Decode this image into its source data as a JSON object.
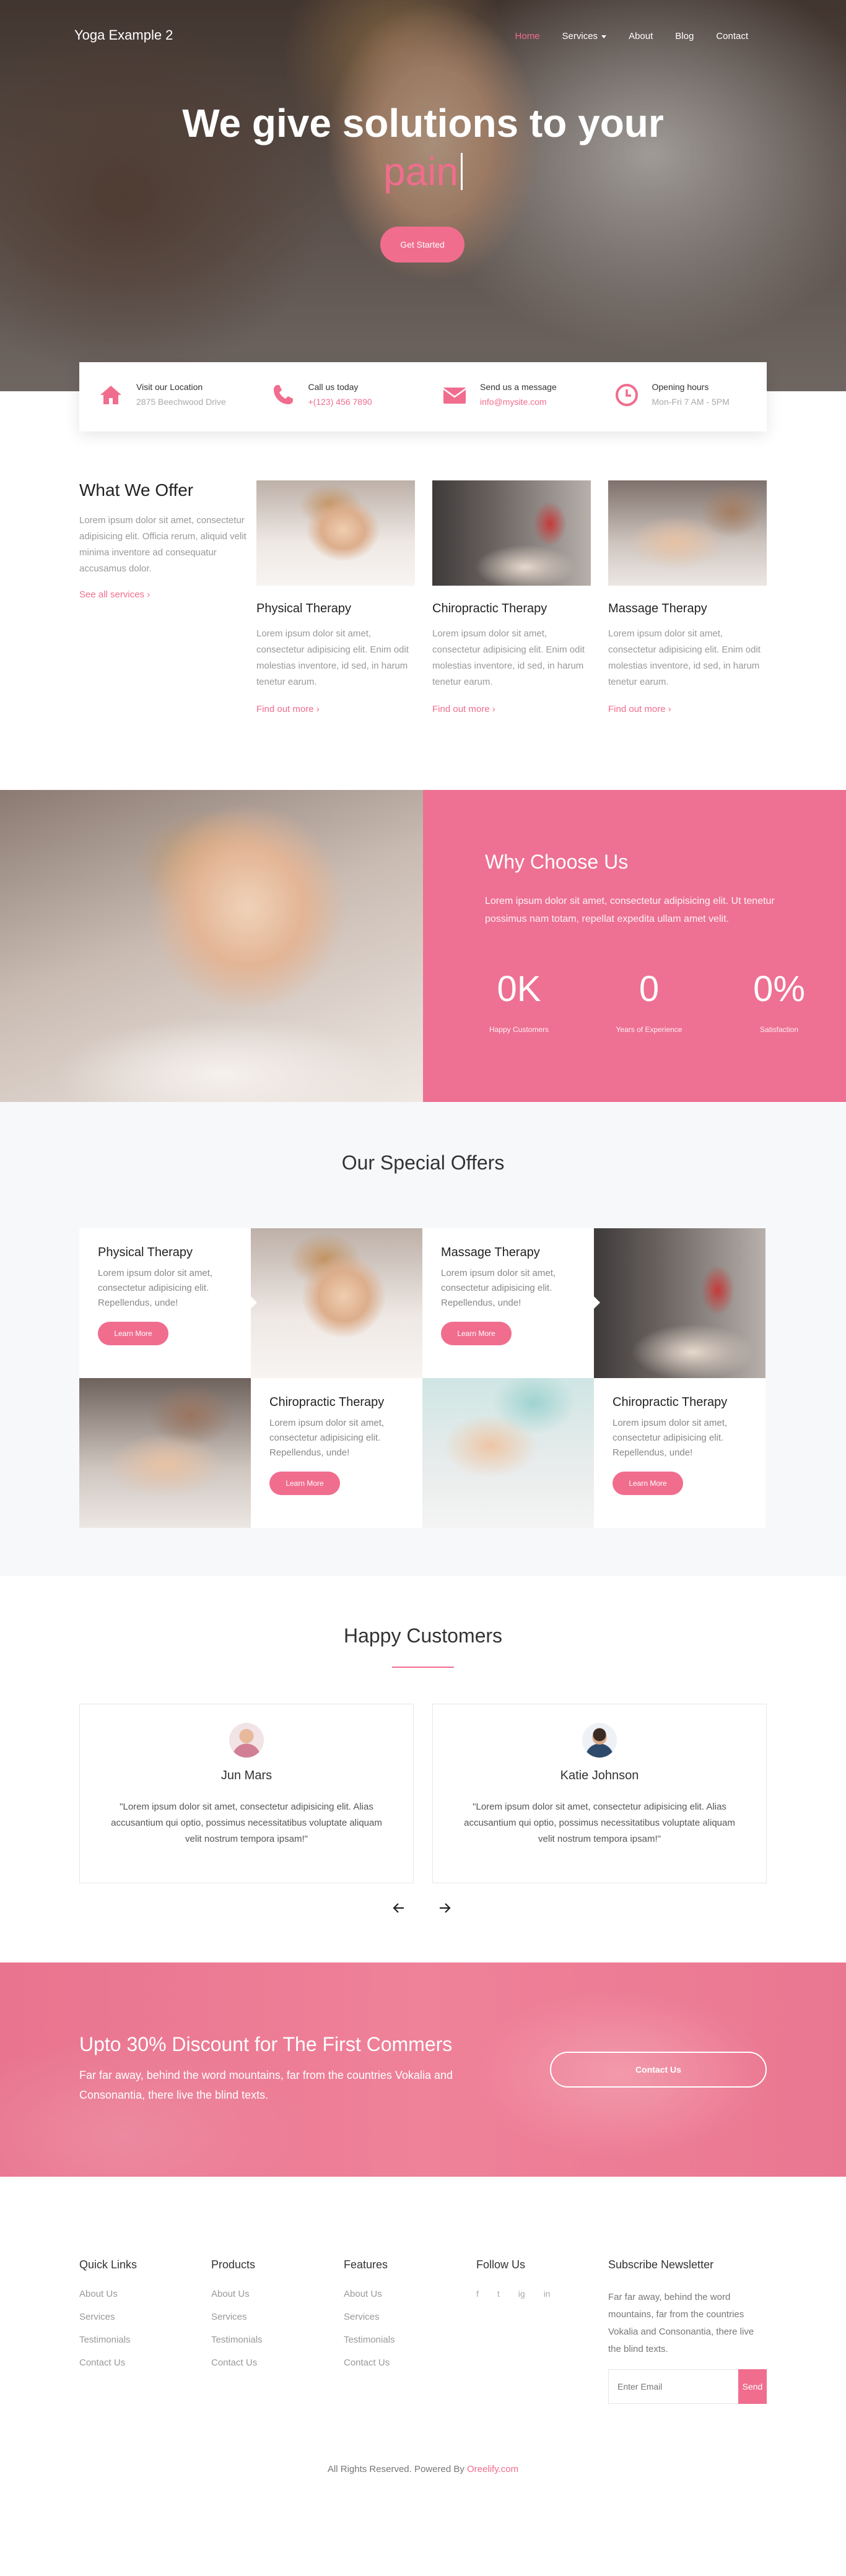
{
  "nav": {
    "brand": "Yoga Example 2",
    "items": [
      {
        "label": "Home",
        "active": true
      },
      {
        "label": "Services",
        "dropdown": true
      },
      {
        "label": "About"
      },
      {
        "label": "Blog"
      },
      {
        "label": "Contact"
      }
    ]
  },
  "hero": {
    "title": "We give solutions to your",
    "typed_word": "pain",
    "button": "Get Started"
  },
  "info": [
    {
      "icon": "home-icon",
      "title": "Visit our Location",
      "text": "2875 Beechwood Drive",
      "pink": false
    },
    {
      "icon": "phone-icon",
      "title": "Call us today",
      "text": "+(123) 456 7890",
      "pink": true
    },
    {
      "icon": "envelope-icon",
      "title": "Send us a message",
      "text": "info@mysite.com",
      "pink": true
    },
    {
      "icon": "clock-icon",
      "title": "Opening hours",
      "text": "Mon-Fri 7 AM - 5PM",
      "pink": false
    }
  ],
  "offer": {
    "title": "What We Offer",
    "text": "Lorem ipsum dolor sit amet, consectetur adipisicing elit. Officia rerum, aliquid velit minima inventore ad consequatur accusamus dolor.",
    "link": "See all services",
    "services": [
      {
        "title": "Physical Therapy",
        "text": "Lorem ipsum dolor sit amet, consectetur adipisicing elit. Enim odit molestias inventore, id sed, in harum tenetur earum.",
        "link": "Find out more"
      },
      {
        "title": "Chiropractic Therapy",
        "text": "Lorem ipsum dolor sit amet, consectetur adipisicing elit. Enim odit molestias inventore, id sed, in harum tenetur earum.",
        "link": "Find out more"
      },
      {
        "title": "Massage Therapy",
        "text": "Lorem ipsum dolor sit amet, consectetur adipisicing elit. Enim odit molestias inventore, id sed, in harum tenetur earum.",
        "link": "Find out more"
      }
    ]
  },
  "why": {
    "title": "Why Choose Us",
    "text": "Lorem ipsum dolor sit amet, consectetur adipisicing elit. Ut tenetur possimus nam totam, repellat expedita ullam amet velit.",
    "stats": [
      {
        "value": "0K",
        "label": "Happy Customers"
      },
      {
        "value": "0",
        "label": "Years of Experience"
      },
      {
        "value": "0%",
        "label": "Satisfaction"
      }
    ]
  },
  "special": {
    "title": "Our Special Offers",
    "cards": [
      {
        "title": "Physical Therapy",
        "text": "Lorem ipsum dolor sit amet, consectetur adipisicing elit. Repellendus, unde!",
        "button": "Learn More"
      },
      {
        "title": "Massage Therapy",
        "text": "Lorem ipsum dolor sit amet, consectetur adipisicing elit. Repellendus, unde!",
        "button": "Learn More"
      },
      {
        "title": "Chiropractic Therapy",
        "text": "Lorem ipsum dolor sit amet, consectetur adipisicing elit. Repellendus, unde!",
        "button": "Learn More"
      },
      {
        "title": "Chiropractic Therapy",
        "text": "Lorem ipsum dolor sit amet, consectetur adipisicing elit. Repellendus, unde!",
        "button": "Learn More"
      }
    ]
  },
  "customers": {
    "title": "Happy Customers",
    "testimonials": [
      {
        "name": "Jun Mars",
        "quote": "\"Lorem ipsum dolor sit amet, consectetur adipisicing elit. Alias accusantium qui optio, possimus necessitatibus voluptate aliquam velit nostrum tempora ipsam!\""
      },
      {
        "name": "Katie Johnson",
        "quote": "\"Lorem ipsum dolor sit amet, consectetur adipisicing elit. Alias accusantium qui optio, possimus necessitatibus voluptate aliquam velit nostrum tempora ipsam!\""
      }
    ]
  },
  "discount": {
    "title": "Upto 30% Discount for The First Commers",
    "text": "Far far away, behind the word mountains, far from the countries Vokalia and Consonantia, there live the blind texts.",
    "button": "Contact Us"
  },
  "footer": {
    "quick_links": {
      "title": "Quick Links",
      "items": [
        "About Us",
        "Services",
        "Testimonials",
        "Contact Us"
      ]
    },
    "products": {
      "title": "Products",
      "items": [
        "About Us",
        "Services",
        "Testimonials",
        "Contact Us"
      ]
    },
    "features": {
      "title": "Features",
      "items": [
        "About Us",
        "Services",
        "Testimonials",
        "Contact Us"
      ]
    },
    "follow": {
      "title": "Follow Us",
      "icons": [
        "f",
        "t",
        "ig",
        "in"
      ]
    },
    "newsletter": {
      "title": "Subscribe Newsletter",
      "text": "Far far away, behind the word mountains, far from the countries Vokalia and Consonantia, there live the blind texts.",
      "placeholder": "Enter Email",
      "button": "Send"
    },
    "copyright": "All Rights Reserved. Powered By",
    "copyright_link": "Oreelify.com"
  },
  "colors": {
    "accent": "#f06d8e",
    "why_bg": "#ee7093"
  }
}
